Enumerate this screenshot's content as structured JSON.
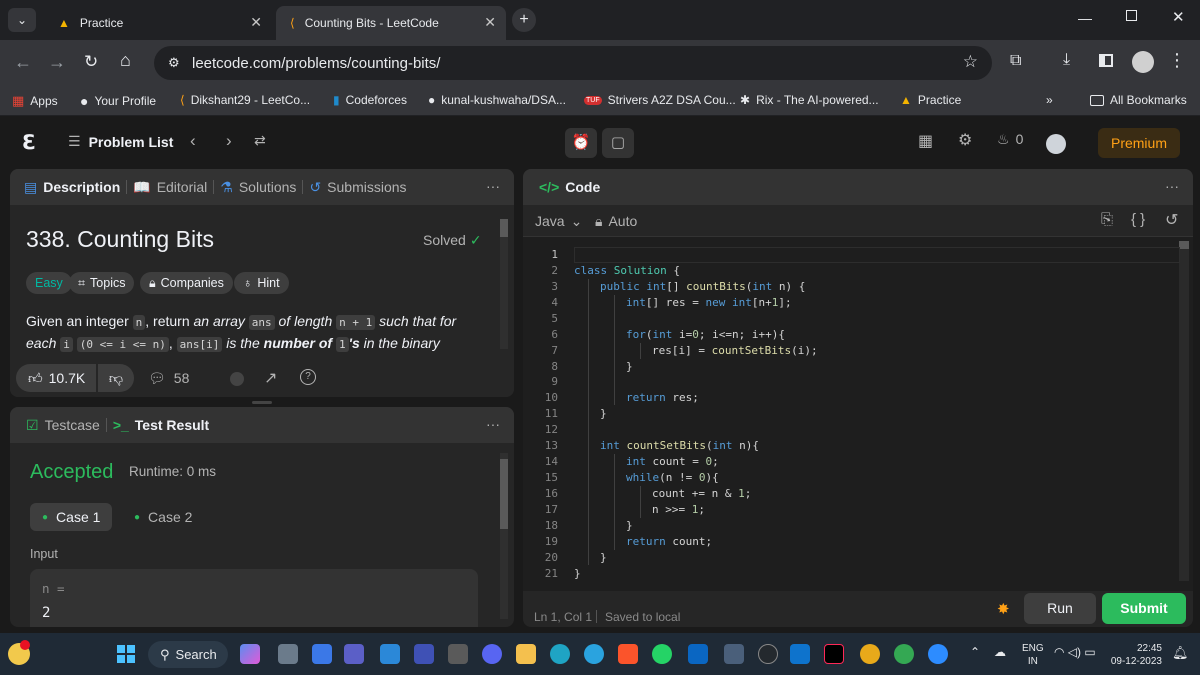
{
  "browser": {
    "tabs": [
      {
        "title": "Practice",
        "active": false
      },
      {
        "title": "Counting Bits - LeetCode",
        "active": true
      }
    ],
    "url": "leetcode.com/problems/counting-bits/",
    "bookmarks": [
      {
        "label": "Apps",
        "icon": "apps-grid-icon"
      },
      {
        "label": "Your Profile",
        "icon": "github-icon"
      },
      {
        "label": "Dikshant29 - LeetCo...",
        "icon": "leetcode-icon"
      },
      {
        "label": "Codeforces",
        "icon": "codeforces-icon"
      },
      {
        "label": "kunal-kushwaha/DSA...",
        "icon": "github-icon"
      },
      {
        "label": "Strivers A2Z DSA Cou...",
        "icon": "tuf-icon"
      },
      {
        "label": "Rix - The AI-powered...",
        "icon": "rix-icon"
      },
      {
        "label": "Practice",
        "icon": "gfg-icon"
      }
    ],
    "all_bookmarks": "All Bookmarks"
  },
  "nav": {
    "problem_list": "Problem List",
    "streak": "0",
    "premium": "Premium"
  },
  "description_panel": {
    "tabs": [
      "Description",
      "Editorial",
      "Solutions",
      "Submissions"
    ],
    "title": "338. Counting Bits",
    "status": "Solved",
    "difficulty": "Easy",
    "tags": [
      "Topics",
      "Companies",
      "Hint"
    ],
    "text": {
      "p1": "Given an integer ",
      "c1": "n",
      "p2": ", return ",
      "e1": "an array ",
      "c2": "ans",
      "e2": " of length ",
      "c3": "n + 1",
      "e3": " such that for",
      "e4": "each ",
      "c4": "i",
      "c5": "(0 <= i <= n)",
      "p3": ", ",
      "c6": "ans[i]",
      "e5": " is the ",
      "b1": "number of ",
      "c7": "1",
      "b2": "'s",
      "e6": " in the binary"
    },
    "likes": "10.7K",
    "comments": "58"
  },
  "test_panel": {
    "tabs": [
      "Testcase",
      "Test Result"
    ],
    "result": "Accepted",
    "runtime": "Runtime: 0 ms",
    "cases": [
      "Case 1",
      "Case 2"
    ],
    "input_label": "Input",
    "var_label": "n =",
    "var_value": "2"
  },
  "code_panel": {
    "title": "Code",
    "language": "Java",
    "mode": "Auto",
    "line_numbers": [
      "1",
      "2",
      "3",
      "4",
      "5",
      "6",
      "7",
      "8",
      "9",
      "10",
      "11",
      "12",
      "13",
      "14",
      "15",
      "16",
      "17",
      "18",
      "19",
      "20",
      "21"
    ],
    "status_pos": "Ln 1, Col 1",
    "status_save": "Saved to local",
    "run": "Run",
    "submit": "Submit"
  },
  "taskbar": {
    "search": "Search",
    "lang": "ENG",
    "region": "IN",
    "time": "22:45",
    "date": "09-12-2023"
  },
  "colors": {
    "accent_green": "#2cbb5d",
    "easy": "#00b8a3",
    "premium": "#ffa116",
    "background": "#1a1a1a",
    "panel": "#262626"
  }
}
